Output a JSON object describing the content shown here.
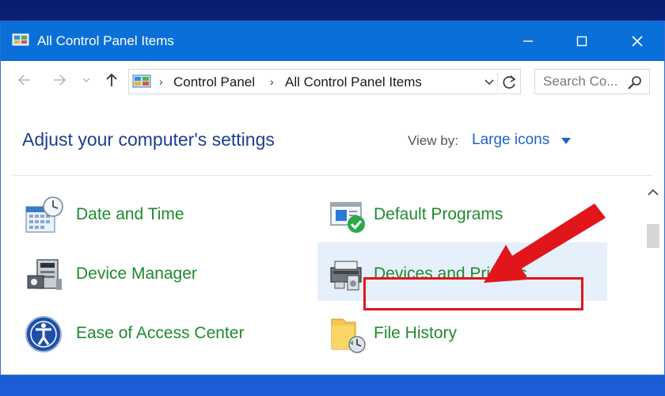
{
  "window": {
    "title": "All Control Panel Items",
    "controls": {
      "minimize": "minimize",
      "maximize": "maximize",
      "close": "close"
    }
  },
  "navigation": {
    "breadcrumbs": [
      "Control Panel",
      "All Control Panel Items"
    ],
    "search_placeholder": "Search Co..."
  },
  "content": {
    "heading": "Adjust your computer's settings",
    "view_by_label": "View by:",
    "view_by_value": "Large icons",
    "items": [
      {
        "label": "Date and Time",
        "icon": "date-time-icon"
      },
      {
        "label": "Default Programs",
        "icon": "default-programs-icon"
      },
      {
        "label": "Device Manager",
        "icon": "device-manager-icon"
      },
      {
        "label": "Devices and Printers",
        "icon": "devices-printers-icon"
      },
      {
        "label": "Ease of Access Center",
        "icon": "ease-of-access-icon"
      },
      {
        "label": "File History",
        "icon": "file-history-icon"
      }
    ]
  },
  "colors": {
    "title_bar": "#0a6fd8",
    "heading": "#1e3f8f",
    "link": "#1f8a2e",
    "accent": "#1f63c6",
    "hover": "#e6f0fb",
    "annotation": "#e0161b"
  }
}
